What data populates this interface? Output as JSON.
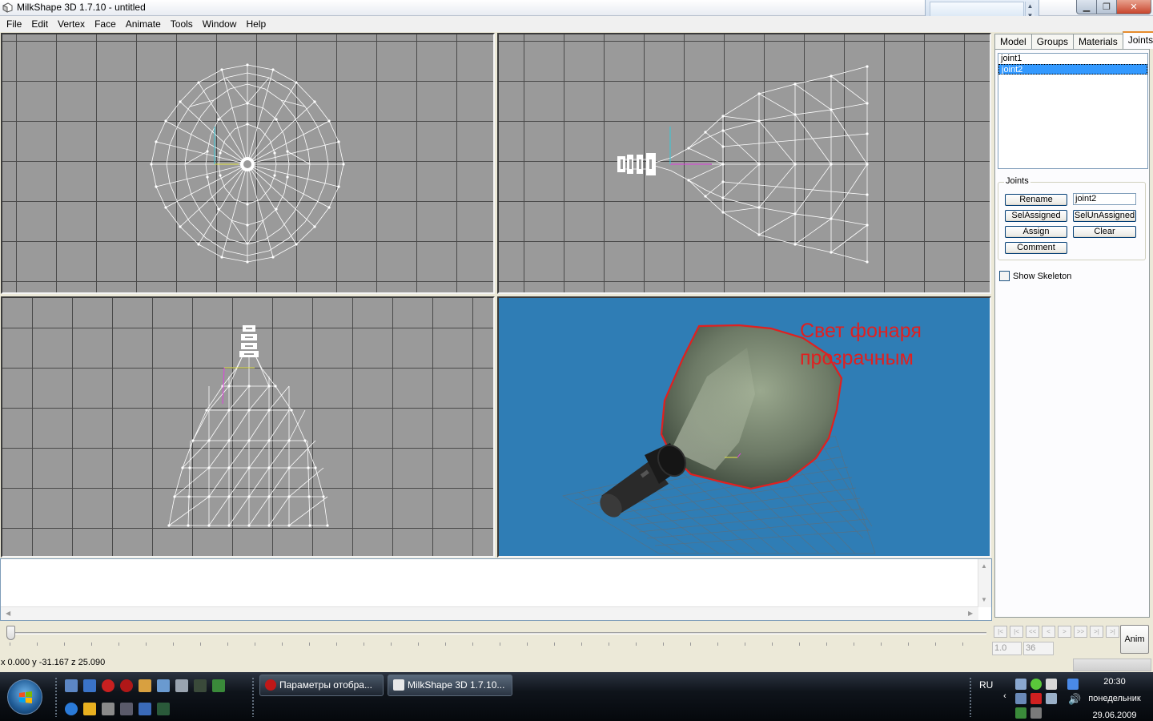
{
  "window": {
    "title": "MilkShape 3D 1.7.10 - untitled"
  },
  "menu": [
    "File",
    "Edit",
    "Vertex",
    "Face",
    "Animate",
    "Tools",
    "Window",
    "Help"
  ],
  "viewports": {
    "overlay_text_line1": "Свет фонаря",
    "overlay_text_line2": "прозрачным",
    "background_3d": "#2f7db5",
    "background_2d": "#9a9a9a",
    "highlight_color": "#e02020"
  },
  "panel": {
    "tabs": [
      "Model",
      "Groups",
      "Materials",
      "Joints"
    ],
    "active_tab": "Joints",
    "joints": [
      "joint1",
      "joint2"
    ],
    "selected_joint": "joint2",
    "group_label": "Joints",
    "buttons": {
      "rename": "Rename",
      "sel_assigned": "SelAssigned",
      "sel_unassigned": "SelUnAssigned",
      "assign": "Assign",
      "clear": "Clear",
      "comment": "Comment"
    },
    "name_field_value": "joint2",
    "show_skeleton_label": "Show Skeleton",
    "show_skeleton_checked": false
  },
  "animation": {
    "nav_buttons": [
      "|<",
      "|<",
      "<<",
      "<",
      ">",
      ">>",
      ">|",
      ">|"
    ],
    "frame_current": "1.0",
    "frame_total": "36",
    "anim_label": "Anim"
  },
  "status": {
    "coords": "x 0.000 y -31.167 z 25.090"
  },
  "taskbar": {
    "tasks": [
      {
        "label": "Параметры отобра...",
        "icon": "opera-icon"
      },
      {
        "label": "MilkShape 3D 1.7.10...",
        "icon": "milkshape-icon"
      }
    ],
    "language": "RU",
    "time": "20:30",
    "day": "понедельник",
    "date": "29.06.2009"
  }
}
